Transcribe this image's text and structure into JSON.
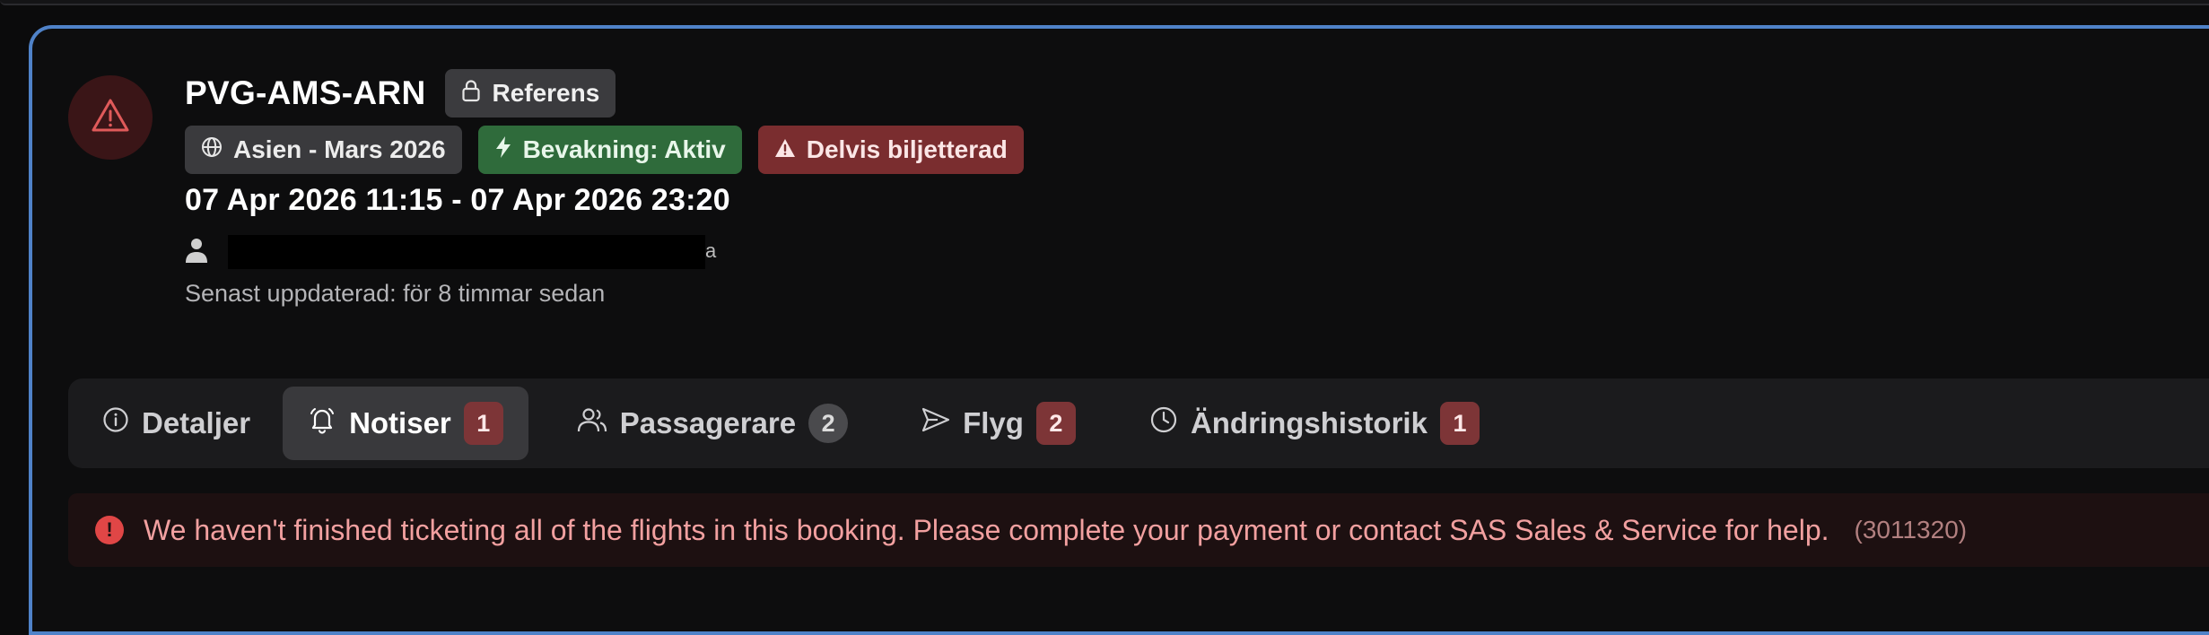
{
  "booking": {
    "route": "PVG-AMS-ARN",
    "reference_label": "Referens",
    "badges": {
      "trip": "Asien - Mars 2026",
      "watch": "Bevakning: Aktiv",
      "ticketing": "Delvis biljetterad"
    },
    "date_range": "07 Apr 2026 11:15 - 07 Apr 2026 23:20",
    "last_updated": "Senast uppdaterad: för 8 timmar sedan"
  },
  "tabs": [
    {
      "label": "Detaljer",
      "count": null
    },
    {
      "label": "Notiser",
      "count": "1",
      "active": true
    },
    {
      "label": "Passagerare",
      "count": "2"
    },
    {
      "label": "Flyg",
      "count": "2"
    },
    {
      "label": "Ändringshistorik",
      "count": "1"
    }
  ],
  "alert": {
    "message": "We haven't finished ticketing all of the flights in this booking. Please complete your payment or contact SAS Sales & Service for help.",
    "code": "(3011320)"
  },
  "colors": {
    "accent_border": "#4f82c8",
    "watch_green": "#2f6b3b",
    "ticket_red": "#7a2d2f",
    "alert_text": "#f2a0a0"
  }
}
